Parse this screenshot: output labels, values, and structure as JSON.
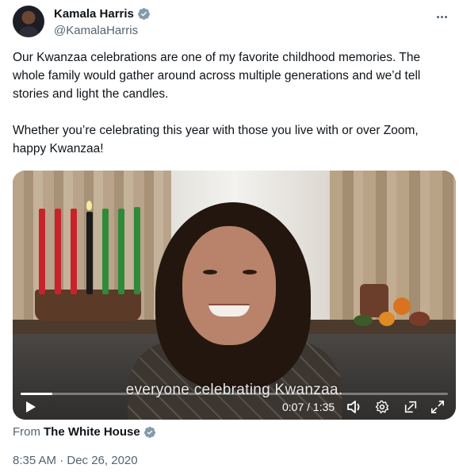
{
  "author": {
    "name": "Kamala Harris",
    "handle": "@KamalaHarris",
    "verified_icon": "verified-badge-icon"
  },
  "tweet": {
    "text": "Our Kwanzaa celebrations are one of my favorite childhood memories. The whole family would gather around across multiple generations and we’d tell stories and light the candles.\n\nWhether you’re celebrating this year with those you live with or over Zoom, happy Kwanzaa!"
  },
  "video": {
    "caption": "everyone celebrating Kwanzaa.",
    "time": "0:07 / 1:35",
    "progress": 0.074,
    "controls": [
      "play-icon",
      "volume-icon",
      "settings-icon",
      "pip-icon",
      "fullscreen-icon"
    ]
  },
  "source": {
    "prefix": "From",
    "name": "The White House"
  },
  "timestamp": "8:35 AM · Dec 26, 2020",
  "colors": {
    "text": "#0f1419",
    "secondary": "#536471",
    "verified": "#829aab"
  }
}
